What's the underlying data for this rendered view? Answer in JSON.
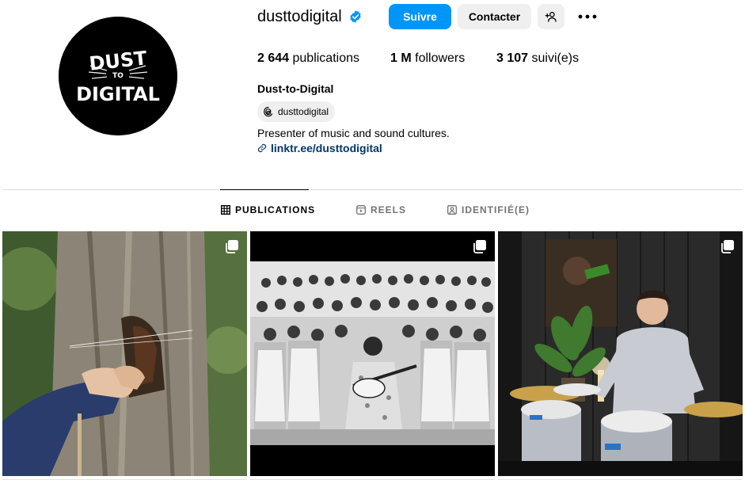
{
  "profile": {
    "username": "dusttodigital",
    "verified_icon": "verified-badge-icon",
    "avatar_text_top": "DUST",
    "avatar_text_mid": "TO",
    "avatar_text_bottom": "DIGITAL",
    "full_name": "Dust-to-Digital",
    "threads_handle": "dusttodigital",
    "bio": "Presenter of music and sound cultures.",
    "link": "linktr.ee/dusttodigital"
  },
  "actions": {
    "follow_label": "Suivre",
    "contact_label": "Contacter",
    "add_user_icon": "add-person-icon",
    "more_icon": "more-options-icon"
  },
  "stats": {
    "posts_count": "2 644",
    "posts_label": "publications",
    "followers_count": "1 M",
    "followers_label": "followers",
    "following_count": "3 107",
    "following_label": "suivi(e)s"
  },
  "tabs": [
    {
      "label": "PUBLICATIONS",
      "icon": "grid-icon",
      "active": true
    },
    {
      "label": "REELS",
      "icon": "reels-icon",
      "active": false
    },
    {
      "label": "IDENTIFIÉ(E)",
      "icon": "tagged-icon",
      "active": false
    }
  ],
  "posts": [
    {
      "type": "carousel",
      "icon": "carousel-icon"
    },
    {
      "type": "carousel",
      "icon": "carousel-icon"
    },
    {
      "type": "carousel",
      "icon": "carousel-icon"
    }
  ],
  "colors": {
    "primary": "#0095f6",
    "secondary_button": "#efefef",
    "link": "#00376b",
    "muted": "#737373",
    "divider": "#dbdbdb"
  }
}
